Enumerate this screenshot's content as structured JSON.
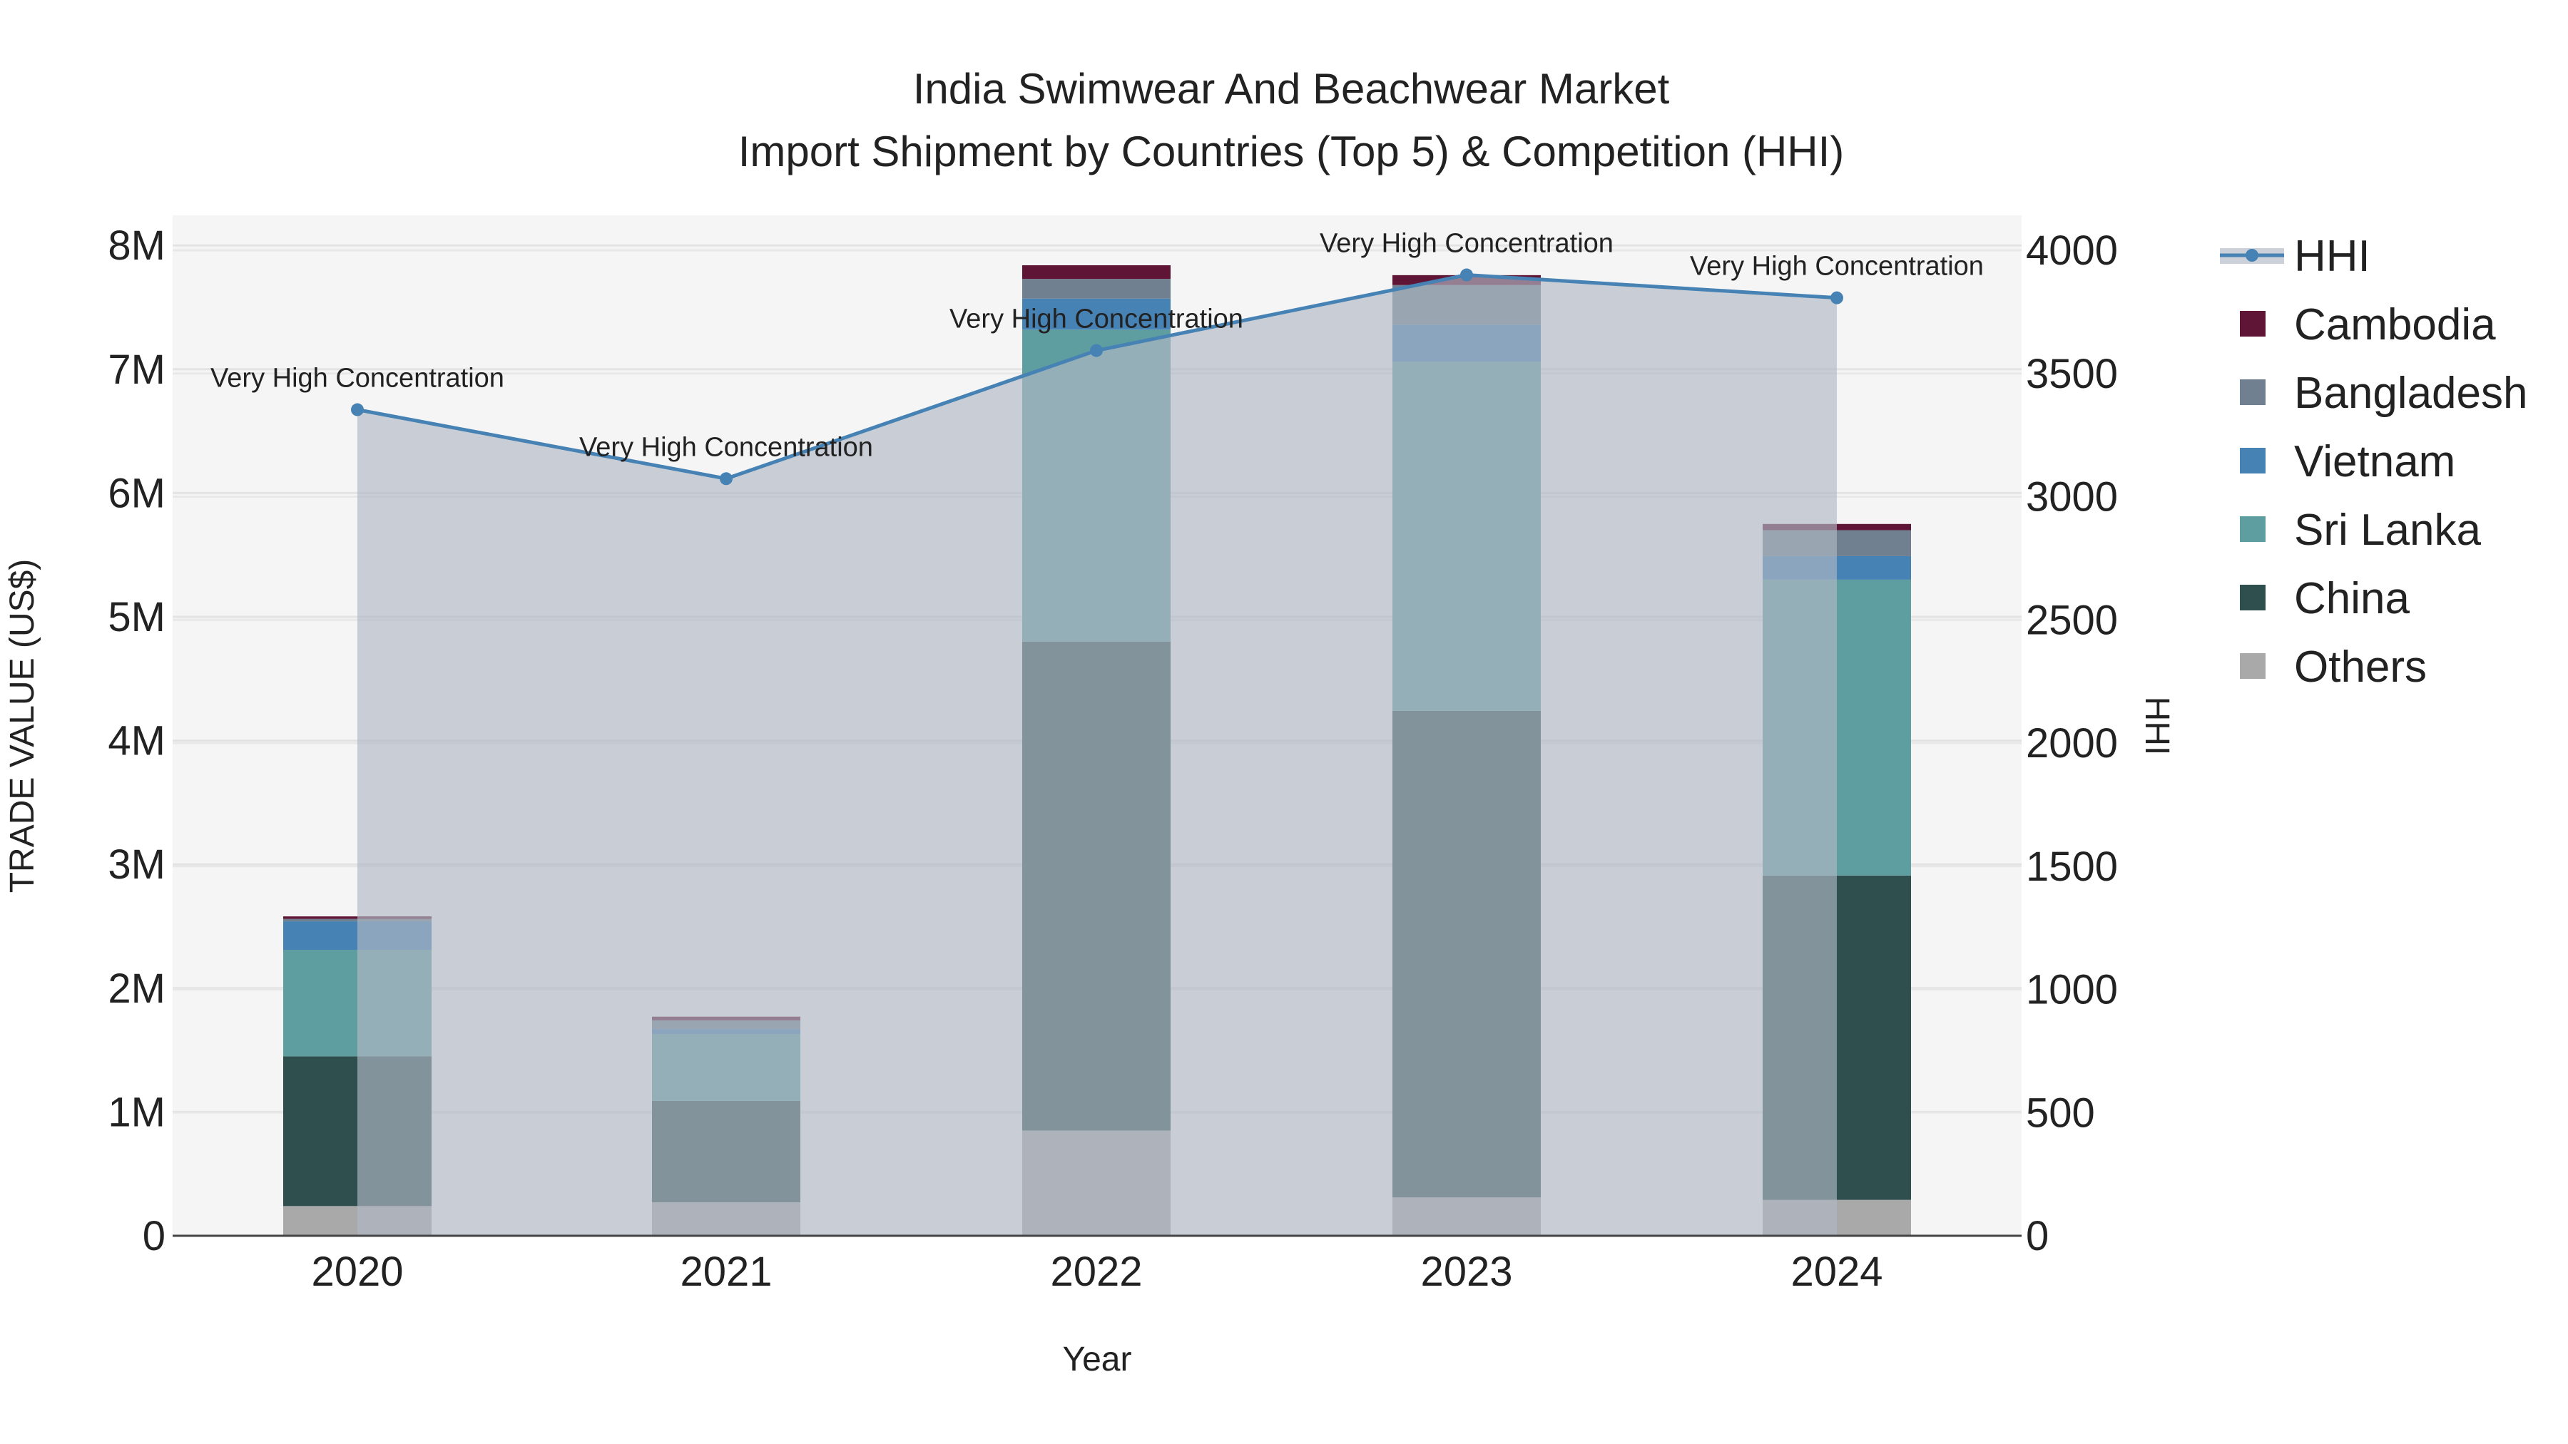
{
  "chart_data": {
    "type": "bar",
    "title": "India Swimwear And Beachwear Market",
    "subtitle": "Import Shipment by Countries (Top 5) & Competition (HHI)",
    "xlabel": "Year",
    "ylabel": "TRADE VALUE (US$)",
    "y2label": "HHI",
    "categories": [
      "2020",
      "2021",
      "2022",
      "2023",
      "2024"
    ],
    "ylim": [
      0,
      8200000
    ],
    "y_ticks": [
      0,
      1000000,
      2000000,
      3000000,
      4000000,
      5000000,
      6000000,
      7000000,
      8000000
    ],
    "y_tick_labels": [
      "0",
      "1M",
      "2M",
      "3M",
      "4M",
      "5M",
      "6M",
      "7M",
      "8M"
    ],
    "y2lim": [
      0,
      4100
    ],
    "y2_ticks": [
      0,
      500,
      1000,
      1500,
      2000,
      2500,
      3000,
      3500,
      4000
    ],
    "y2_tick_labels": [
      "0",
      "500",
      "1000",
      "1500",
      "2000",
      "2500",
      "3000",
      "3500",
      "4000"
    ],
    "stacked": true,
    "series": [
      {
        "name": "Others",
        "color": "#a9a9a9",
        "values": [
          240000,
          270000,
          850000,
          310000,
          290000
        ]
      },
      {
        "name": "China",
        "color": "#2f4f4f",
        "values": [
          1210000,
          820000,
          3950000,
          3930000,
          2620000
        ]
      },
      {
        "name": "Sri Lanka",
        "color": "#5f9ea0",
        "values": [
          860000,
          540000,
          2520000,
          2820000,
          2390000
        ]
      },
      {
        "name": "Vietnam",
        "color": "#4682b4",
        "values": [
          230000,
          40000,
          250000,
          300000,
          190000
        ]
      },
      {
        "name": "Bangladesh",
        "color": "#708090",
        "values": [
          20000,
          70000,
          160000,
          320000,
          210000
        ]
      },
      {
        "name": "Cambodia",
        "color": "#5f1535",
        "values": [
          20000,
          30000,
          110000,
          80000,
          50000
        ]
      }
    ],
    "line": {
      "name": "HHI",
      "color": "#4682b4",
      "axis": "right",
      "values": [
        3353,
        3073,
        3593,
        3900,
        3807
      ],
      "annotations": [
        "Very High Concentration",
        "Very High Concentration",
        "Very High Concentration",
        "Very High Concentration",
        "Very High Concentration"
      ]
    },
    "legend": {
      "placement": "right",
      "entries": [
        "HHI",
        "Cambodia",
        "Bangladesh",
        "Vietnam",
        "Sri Lanka",
        "China",
        "Others"
      ]
    },
    "grid": true
  }
}
